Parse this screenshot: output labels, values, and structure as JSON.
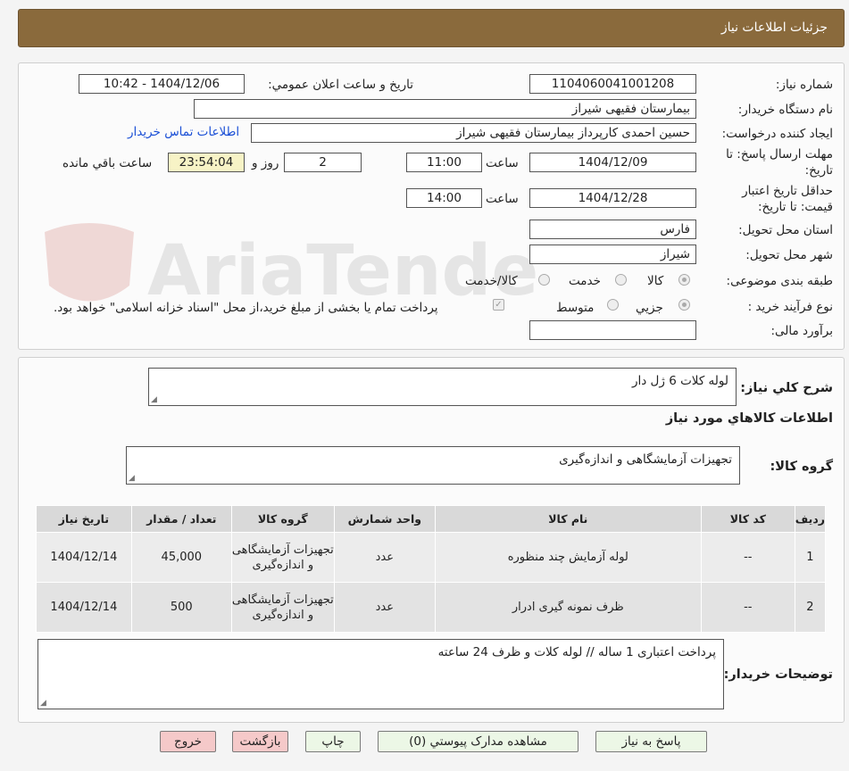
{
  "header": {
    "title": "جزئیات اطلاعات نیاز"
  },
  "labels": {
    "need_number": "شماره نیاز:",
    "announce_datetime": "تاریخ و ساعت اعلان عمومي:",
    "buyer_org": "نام دستگاه خريدار:",
    "requester": "ايجاد کننده درخواست:",
    "send_deadline": "مهلت ارسال پاسخ: تا تاریخ:",
    "validity_deadline": "حداقل تاريخ اعتبار قيمت: تا تاريخ:",
    "delivery_province": "استان محل تحويل:",
    "delivery_city": "شهر محل تحويل:",
    "category": "طبقه بندی موضوعی:",
    "purchase_type": "نوع فرآيند خريد :",
    "budget": "برآورد مالی:",
    "time": "ساعت",
    "day_and": "روز و",
    "time_remaining": "ساعت باقي مانده",
    "general_desc": "شرح کلي نياز:",
    "goods_info": "اطلاعات کالاهاي مورد نياز",
    "goods_group": "گروه کالا:",
    "buyer_notes": "توضيحات خريدار:"
  },
  "values": {
    "need_number": "1104060041001208",
    "announce_datetime": "1404/12/06 - 10:42",
    "buyer_org": "بیمارستان فقیهی شیراز",
    "requester": "حسین احمدی کارپرداز بیمارستان فقیهی شیراز",
    "buyer_contact_link": "اطلاعات تماس خريدار",
    "send_date": "1404/12/09",
    "send_time": "11:00",
    "days": "2",
    "remaining_time": "23:54:04",
    "validity_date": "1404/12/28",
    "validity_time": "14:00",
    "province": "فارس",
    "city": "شیراز",
    "budget": "",
    "general_desc": "لوله کلات 6 ژل دار",
    "goods_group": "تجهیزات آزمایشگاهی و اندازه‌گیری",
    "buyer_notes": "پرداخت اعتباری 1 ساله // لوله کلات و ظرف 24 ساعته"
  },
  "category_options": {
    "goods": "کالا",
    "service": "خدمت",
    "goods_service": "کالا/خدمت",
    "selected": "goods"
  },
  "purchase_options": {
    "minor": "جزيي",
    "medium": "متوسط",
    "selected": "minor",
    "treasury_note": "پرداخت تمام يا بخشی از مبلغ خريد،از محل \"اسناد خزانه اسلامی\" خواهد بود."
  },
  "table": {
    "headers": [
      "رديف",
      "کد کالا",
      "نام کالا",
      "واحد شمارش",
      "گروه کالا",
      "تعداد / مقدار",
      "تاريخ نياز"
    ],
    "rows": [
      [
        "1",
        "--",
        "لوله آزمایش چند منظوره",
        "عدد",
        "تجهیزات آزمایشگاهی و اندازه‌گیری",
        "45,000",
        "1404/12/14"
      ],
      [
        "2",
        "--",
        "ظرف نمونه گیری ادرار",
        "عدد",
        "تجهیزات آزمایشگاهی و اندازه‌گیری",
        "500",
        "1404/12/14"
      ]
    ]
  },
  "buttons": {
    "reply": "پاسخ به نياز",
    "attachments": "مشاهده مدارک پيوستي (0)",
    "print": "چاپ",
    "back": "بازگشت",
    "exit": "خروج"
  },
  "colors": {
    "header_bg": "#8a6a3c",
    "link": "#1a4fd6",
    "exit_btn": "#f5c9c9",
    "main_btn": "#ecf7e6"
  }
}
